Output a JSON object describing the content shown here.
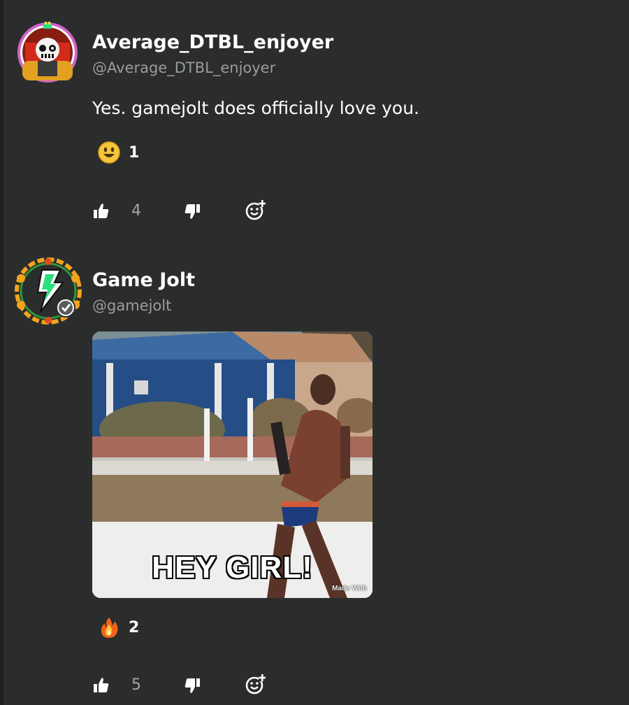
{
  "comments": [
    {
      "display_name": "Average_DTBL_enjoyer",
      "handle": "@Average_DTBL_enjoyer",
      "text": "Yes. gamejolt does officially love you.",
      "reaction": {
        "icon": "smiley-face-emoji",
        "count": "1"
      },
      "likes": "4",
      "avatar": {
        "icon": "skeleton-character-avatar",
        "ring_color": "#d064c6"
      }
    },
    {
      "display_name": "Game Jolt",
      "handle": "@gamejolt",
      "verified": true,
      "media": {
        "type": "gif",
        "caption": "HEY GIRL!",
        "watermark": "Made With"
      },
      "reaction": {
        "icon": "fire-emoji",
        "count": "2"
      },
      "likes": "5",
      "avatar": {
        "icon": "gamejolt-lightning-logo-avatar",
        "frame_color": "#f3a41d"
      }
    }
  ],
  "theme": {
    "background": "#2b2d2d",
    "muted_text": "#9b9d9d",
    "accent_green": "#2ce07f"
  }
}
